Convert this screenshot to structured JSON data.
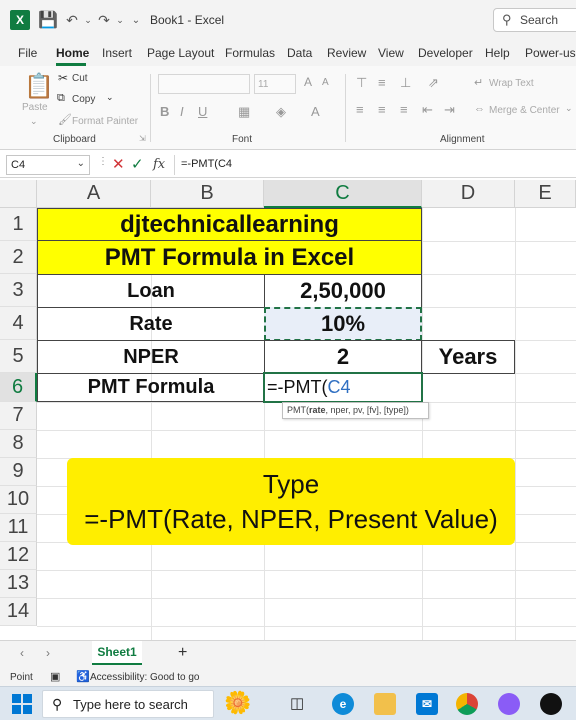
{
  "window": {
    "title": "Book1  -  Excel",
    "app_icon": "X",
    "search_placeholder": "Search"
  },
  "menu": {
    "tabs": [
      "File",
      "Home",
      "Insert",
      "Page Layout",
      "Formulas",
      "Data",
      "Review",
      "View",
      "Developer",
      "Help",
      "Power-use"
    ],
    "active": "Home"
  },
  "ribbon": {
    "clipboard": {
      "paste": "Paste",
      "cut": "Cut",
      "copy": "Copy",
      "format_painter": "Format Painter",
      "group_label": "Clipboard"
    },
    "font": {
      "size": "11",
      "group_label": "Font"
    },
    "alignment": {
      "wrap_text": "Wrap Text",
      "merge_center": "Merge & Center",
      "group_label": "Alignment"
    }
  },
  "formula_bar": {
    "name_box": "C4",
    "fx": "fx",
    "content": "=-PMT(C4"
  },
  "grid": {
    "columns": [
      "A",
      "B",
      "C",
      "D",
      "E"
    ],
    "selected_column": "C",
    "rows": [
      "1",
      "2",
      "3",
      "4",
      "5",
      "6",
      "7",
      "8",
      "9",
      "10",
      "11",
      "12",
      "13",
      "14"
    ],
    "selected_row": "6",
    "cells": {
      "r1": "djtechnicallearning",
      "r2": "PMT Formula in Excel",
      "r3_label": "Loan",
      "r3_value": "2,50,000",
      "r4_label": "Rate",
      "r4_value": "10%",
      "r5_label": "NPER",
      "r5_value": "2",
      "r5_unit": "Years",
      "r6_label": "PMT Formula",
      "r6_edit_prefix": "=-PMT(",
      "r6_edit_ref": "C4"
    },
    "tooltip": {
      "fn": "PMT(",
      "arg_bold": "rate",
      "rest": ", nper, pv, [fv], [type])"
    },
    "callout": {
      "line1": "Type",
      "line2": "=-PMT(Rate, NPER, Present Value)"
    }
  },
  "sheets": {
    "tabs": [
      "Sheet1"
    ],
    "add": "+"
  },
  "status": {
    "mode": "Point",
    "accessibility": "Accessibility: Good to go"
  },
  "taskbar": {
    "search_placeholder": "Type here to search"
  },
  "colors": {
    "excel_green": "#107c41",
    "highlight_yellow": "#ffff00",
    "callout_yellow": "#ffee00",
    "ref_blue": "#2f6fc2"
  }
}
